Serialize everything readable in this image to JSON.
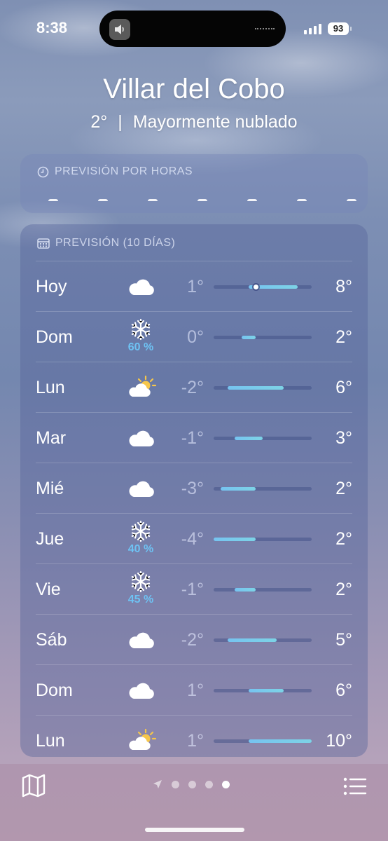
{
  "status_bar": {
    "time": "8:38",
    "battery": "93"
  },
  "location": {
    "city": "Villar del Cobo",
    "current_temp": "2°",
    "separator": "|",
    "condition": "Mayormente nublado"
  },
  "hourly": {
    "header": "PREVISIÓN POR HORAS"
  },
  "daily": {
    "header": "PREVISIÓN (10 DÍAS)",
    "range_min": -4,
    "range_max": 10,
    "rows": [
      {
        "day": "Hoy",
        "icon": "cloud-icon",
        "precip": "",
        "low": "1°",
        "high": "8°",
        "low_val": 1,
        "high_val": 8,
        "current": 2
      },
      {
        "day": "Dom",
        "icon": "snowflake-icon",
        "precip": "60 %",
        "low": "0°",
        "high": "2°",
        "low_val": 0,
        "high_val": 2
      },
      {
        "day": "Lun",
        "icon": "partly-sunny-icon",
        "precip": "",
        "low": "-2°",
        "high": "6°",
        "low_val": -2,
        "high_val": 6
      },
      {
        "day": "Mar",
        "icon": "cloud-icon",
        "precip": "",
        "low": "-1°",
        "high": "3°",
        "low_val": -1,
        "high_val": 3
      },
      {
        "day": "Mié",
        "icon": "cloud-icon",
        "precip": "",
        "low": "-3°",
        "high": "2°",
        "low_val": -3,
        "high_val": 2
      },
      {
        "day": "Jue",
        "icon": "snowflake-icon",
        "precip": "40 %",
        "low": "-4°",
        "high": "2°",
        "low_val": -4,
        "high_val": 2
      },
      {
        "day": "Vie",
        "icon": "snowflake-icon",
        "precip": "45 %",
        "low": "-1°",
        "high": "2°",
        "low_val": -1,
        "high_val": 2
      },
      {
        "day": "Sáb",
        "icon": "cloud-icon",
        "precip": "",
        "low": "-2°",
        "high": "5°",
        "low_val": -2,
        "high_val": 5
      },
      {
        "day": "Dom",
        "icon": "cloud-icon",
        "precip": "",
        "low": "1°",
        "high": "6°",
        "low_val": 1,
        "high_val": 6
      },
      {
        "day": "Lun",
        "icon": "partly-sunny-icon",
        "precip": "",
        "low": "1°",
        "high": "10°",
        "low_val": 1,
        "high_val": 10
      }
    ]
  },
  "bottom_bar": {
    "pages": 4,
    "active_page": 3
  },
  "colors": {
    "bar_fill": "#76c3f0",
    "precip": "#6ec2f3",
    "sun": "#f6c64a"
  }
}
